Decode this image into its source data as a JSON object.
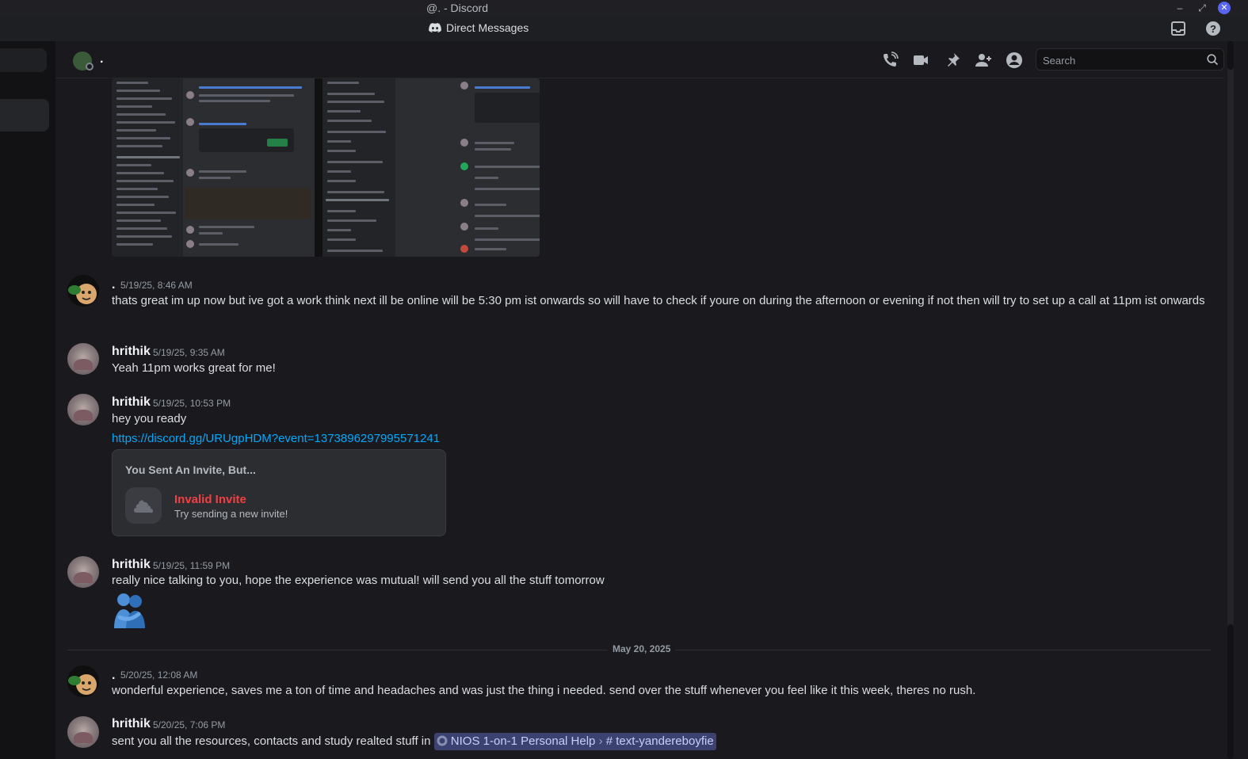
{
  "window": {
    "title": "@. - Discord"
  },
  "topbar": {
    "title": "Direct Messages"
  },
  "header": {
    "name": "."
  },
  "search": {
    "placeholder": "Search"
  },
  "messages": [
    {
      "author": ".",
      "timestamp": "5/19/25, 8:46 AM",
      "text": "thats great im up now but ive got a work think next ill be online will be 5:30 pm ist onwards  so will have to check if youre on during the afternoon or evening if not then will try to set up a call at 11pm ist onwards"
    },
    {
      "author": "hrithik",
      "timestamp": "5/19/25, 9:35 AM",
      "text": "Yeah 11pm works great for me!"
    },
    {
      "author": "hrithik",
      "timestamp": "5/19/25, 10:53 PM",
      "text": "hey you ready",
      "link": "https://discord.gg/URUgpHDM?event=1373896297995571241"
    },
    {
      "author": "hrithik",
      "timestamp": "5/19/25, 11:59 PM",
      "text": "really nice talking to you, hope the experience was mutual! will send you all the stuff tomorrow"
    },
    {
      "author": ".",
      "timestamp": "5/20/25, 12:08 AM",
      "text": "wonderful experience, saves me a ton of time and headaches and was just the thing i needed. send over the stuff whenever you feel like it this week, theres no rush."
    },
    {
      "author": "hrithik",
      "timestamp": "5/20/25, 7:06 PM",
      "text": "sent you all the resources, contacts and study realted stuff in",
      "mention_server": "NIOS 1-on-1 Personal Help",
      "mention_channel": "text-yandereboyfie"
    }
  ],
  "invite": {
    "heading": "You Sent An Invite, But...",
    "title": "Invalid Invite",
    "subtitle": "Try sending a new invite!"
  },
  "date_divider": "May 20, 2025",
  "colors": {
    "accent": "#5865f2",
    "link": "#00a8fc",
    "danger": "#f23f43",
    "mention_bg": "#3c4270"
  }
}
